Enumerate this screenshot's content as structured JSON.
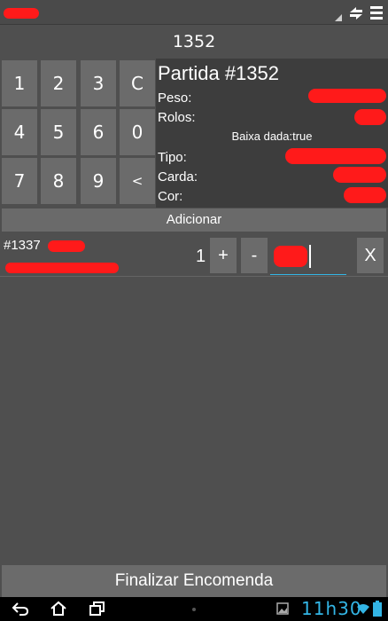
{
  "order": {
    "number": "1352"
  },
  "keypad": {
    "keys": [
      "1",
      "2",
      "3",
      "C",
      "4",
      "5",
      "6",
      "0",
      "7",
      "8",
      "9",
      "<"
    ]
  },
  "info": {
    "title": "Partida #1352",
    "peso_label": "Peso:",
    "rolos_label": "Rolos:",
    "baixa": "Baixa dada:true",
    "tipo_label": "Tipo:",
    "carda_label": "Carda:",
    "cor_label": "Cor:"
  },
  "actions": {
    "add_label": "Adicionar",
    "finalize_label": "Finalizar Encomenda"
  },
  "item": {
    "code": "#1337",
    "quantity": "1",
    "plus": "+",
    "minus": "-",
    "remove": "X"
  },
  "status": {
    "clock": "11h30"
  },
  "colors": {
    "accent": "#33b5e5",
    "redaction": "#ff1a1a"
  },
  "icons": [
    "sync-icon",
    "menu-icon",
    "back-icon",
    "home-icon",
    "recent-apps-icon",
    "gallery-icon",
    "wifi-icon",
    "battery-icon"
  ]
}
